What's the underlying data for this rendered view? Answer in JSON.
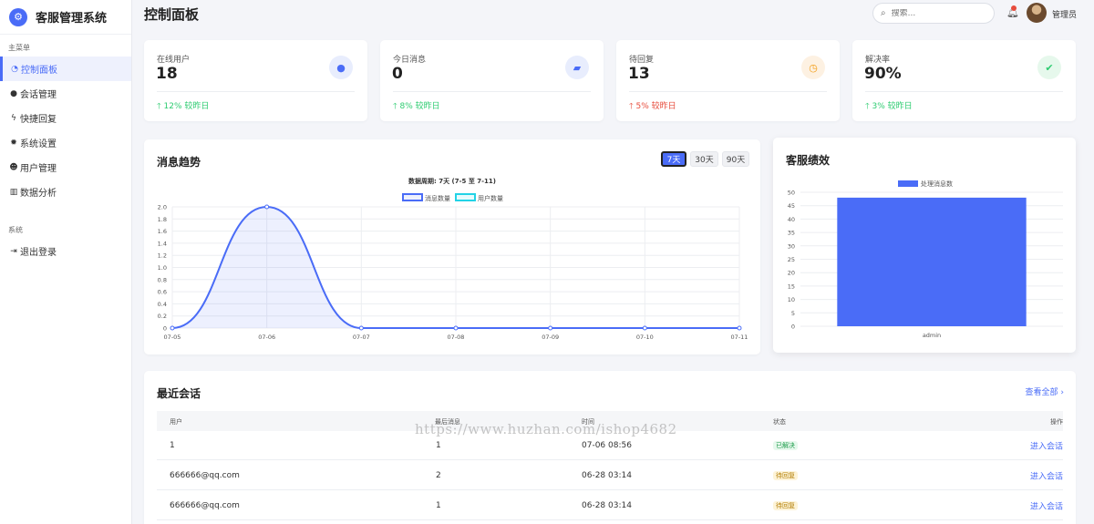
{
  "app": {
    "name": "客服管理系统",
    "logo_icon": "gear-icon"
  },
  "sidebar": {
    "section_main": "主菜单",
    "section_system": "系统",
    "items": [
      {
        "label": "控制面板",
        "icon": "dashboard-icon",
        "active": true
      },
      {
        "label": "会话管理",
        "icon": "chat-icon",
        "active": false
      },
      {
        "label": "快捷回复",
        "icon": "bolt-icon",
        "active": false
      },
      {
        "label": "系统设置",
        "icon": "gear-icon",
        "active": false
      },
      {
        "label": "用户管理",
        "icon": "users-icon",
        "active": false
      },
      {
        "label": "数据分析",
        "icon": "bar-chart-icon",
        "active": false
      }
    ],
    "logout": {
      "label": "退出登录",
      "icon": "logout-icon"
    }
  },
  "header": {
    "title": "控制面板",
    "search_placeholder": "搜索...",
    "user_name": "管理员"
  },
  "stats": [
    {
      "label": "在线用户",
      "value": "18",
      "icon": "user-circle-icon",
      "icon_color": "#4a6cf7",
      "icon_bg": "#e8edfd",
      "trend": "12% 较昨日",
      "direction": "up"
    },
    {
      "label": "今日消息",
      "value": "0",
      "icon": "comments-icon",
      "icon_color": "#4a6cf7",
      "icon_bg": "#e8edfd",
      "trend": "8% 较昨日",
      "direction": "up"
    },
    {
      "label": "待回复",
      "value": "13",
      "icon": "clock-icon",
      "icon_color": "#f39c12",
      "icon_bg": "#fdf1e2",
      "trend": "5% 较昨日",
      "direction": "down"
    },
    {
      "label": "解决率",
      "value": "90%",
      "icon": "check-circle-icon",
      "icon_color": "#2ecc71",
      "icon_bg": "#e6f8ec",
      "trend": "3% 较昨日",
      "direction": "up"
    }
  ],
  "trend_card": {
    "title": "消息趋势",
    "ranges": [
      {
        "label": "7天",
        "active": true
      },
      {
        "label": "30天",
        "active": false
      },
      {
        "label": "90天",
        "active": false
      }
    ]
  },
  "performance_card": {
    "title": "客服绩效"
  },
  "chart_data": [
    {
      "type": "line",
      "title": "数据周期: 7天 (7-5 至 7-11)",
      "categories": [
        "07-05",
        "07-06",
        "07-07",
        "07-08",
        "07-09",
        "07-10",
        "07-11"
      ],
      "series": [
        {
          "name": "消息数量",
          "values": [
            0,
            2,
            0,
            0,
            0,
            0,
            0
          ],
          "color": "#4a6cf7"
        },
        {
          "name": "用户数量",
          "values": [],
          "color": "#22d3e6"
        }
      ],
      "ylim": [
        0,
        2
      ],
      "yticks": [
        "0",
        "0.2",
        "0.4",
        "0.6",
        "0.8",
        "1.0",
        "1.2",
        "1.4",
        "1.6",
        "1.8",
        "2.0"
      ],
      "legend": "top-center",
      "grid": true
    },
    {
      "type": "bar",
      "categories": [
        "admin"
      ],
      "series": [
        {
          "name": "处理消息数",
          "values": [
            48
          ],
          "color": "#4a6cf7"
        }
      ],
      "ylim": [
        0,
        50
      ],
      "yticks": [
        "0",
        "5",
        "10",
        "15",
        "20",
        "25",
        "30",
        "35",
        "40",
        "45",
        "50"
      ],
      "legend": "top-center",
      "grid": true
    }
  ],
  "recent": {
    "title": "最近会话",
    "view_all": "查看全部 ›",
    "columns": [
      "用户",
      "最后消息",
      "时间",
      "状态",
      "操作"
    ],
    "rows": [
      {
        "user": "1",
        "last": "1",
        "time": "07-06 08:56",
        "status": "已解决",
        "status_type": "done",
        "action": "进入会话"
      },
      {
        "user": "666666@qq.com",
        "last": "2",
        "time": "06-28 03:14",
        "status": "待回复",
        "status_type": "wait",
        "action": "进入会话"
      },
      {
        "user": "666666@qq.com",
        "last": "1",
        "time": "06-28 03:14",
        "status": "待回复",
        "status_type": "wait",
        "action": "进入会话"
      }
    ]
  },
  "watermark": "https://www.huzhan.com/ishop4682"
}
